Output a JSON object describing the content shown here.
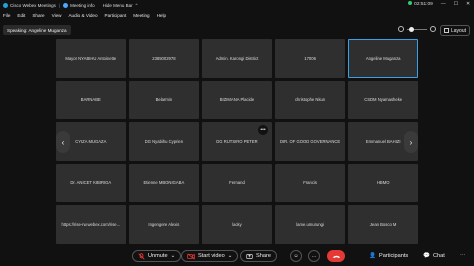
{
  "titlebar": {
    "app_name": "Cisco Webex Meetings",
    "meeting_info": "Meeting info",
    "hide_menu_bar": "Hide Menu Bar",
    "time": "02:51:09",
    "recording_color": "#2ecc71"
  },
  "menubar": [
    "File",
    "Edit",
    "Share",
    "View",
    "Audio & Video",
    "Participant",
    "Meeting",
    "Help"
  ],
  "speaking": "Speaking: Angeline Muganza",
  "layout_label": "Layout",
  "tiles": [
    {
      "name": "Mayor NYABIHU Antoinette"
    },
    {
      "name": "2385002978"
    },
    {
      "name": "Admin. Karongi District"
    },
    {
      "name": "17006"
    },
    {
      "name": "Angeline Muganza",
      "active": true
    },
    {
      "name": "BARNABE"
    },
    {
      "name": "Belarmin"
    },
    {
      "name": "BIZIMANA Placide"
    },
    {
      "name": "christophe Nkun"
    },
    {
      "name": "CSDM Nyamasheke"
    },
    {
      "name": "CYIZA MUGAZA"
    },
    {
      "name": "DG Nyabihu Cyprien"
    },
    {
      "name": "DG RUTSIRO PETER"
    },
    {
      "name": "DIR. OF GOOD GOVERNANCE"
    },
    {
      "name": "Emmanuel BAHIZI"
    },
    {
      "name": "Dr. ANICET KIBIRIGA"
    },
    {
      "name": "Etienne MBONIGABA"
    },
    {
      "name": "Fernand"
    },
    {
      "name": "Francis"
    },
    {
      "name": "HBMO"
    },
    {
      "name": "https://rise-rw.webex.com/rise..."
    },
    {
      "name": "Ingengere Alexis"
    },
    {
      "name": "lacky"
    },
    {
      "name": "lame.umurungi"
    },
    {
      "name": "Jean Bosco M"
    }
  ],
  "controls": {
    "unmute": "Unmute",
    "start_video": "Start video",
    "share": "Share",
    "participants": "Participants",
    "chat": "Chat",
    "mute_color": "#e53935",
    "end_color": "#e53935"
  }
}
